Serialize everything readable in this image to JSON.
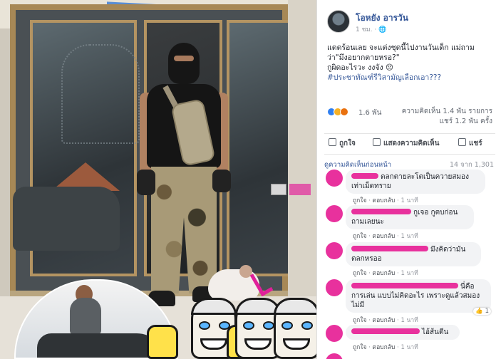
{
  "post": {
    "author": "โอหยัง อารวัน",
    "time": "1 ชม.",
    "globe_icon": "globe-icon",
    "text_line1": "แดดร้อนเลย จะแต่งชุดนี้ไปงานวันเด็ก แม่ถามว่า\"มึงอยากตายหรอ?\"",
    "text_line2": "กูผิดอะไรวะ งงจัง 😔",
    "hashtag": "#ประชาทัณฑ์รีวิสามัญเลือกเอา???"
  },
  "reactions": {
    "count": "1.6 พัน",
    "comments_stat": "ความคิดเห็น 1.4 พัน รายการ",
    "shares_stat": "แชร์ 1.2 พัน ครั้ง",
    "colors": {
      "like": "#2f7ff0",
      "haha": "#f7b125",
      "angry": "#e9710f"
    }
  },
  "actions": {
    "like": "ถูกใจ",
    "comment": "แสดงความคิดเห็น",
    "share": "แชร์"
  },
  "comments_bar": {
    "label": "ดูความคิดเห็นก่อนหน้า",
    "count": "14 จาก 1,301"
  },
  "comments": [
    {
      "text": "ตลกตายละโตเป็นควายสมองเท่าเม็ดทราย",
      "like": "ถูกใจ",
      "reply": "ตอบกลับ",
      "time": "1 นาที"
    },
    {
      "text": "กูเจอ กูตบก่อนถามเลยนะ",
      "like": "ถูกใจ",
      "reply": "ตอบกลับ",
      "time": "1 นาที"
    },
    {
      "text": "มึงคิดว่ามันตลกหรออ",
      "like": "ถูกใจ",
      "reply": "ตอบกลับ",
      "time": "1 นาที"
    },
    {
      "text": "นี่คือการเล่น แบบไม่คิดอะไร เพราะดูแล้วสมองไม่มี",
      "like": "ถูกใจ",
      "reply": "ตอบกลับ",
      "time": "1 นาที",
      "reaction_count": "1"
    },
    {
      "text": "ไอ้ส้นตีน",
      "like": "ถูกใจ",
      "reply": "ตอบกลับ",
      "time": "1 นาที"
    }
  ],
  "brand": {
    "link": "#365899",
    "redact": "#e8319d"
  }
}
